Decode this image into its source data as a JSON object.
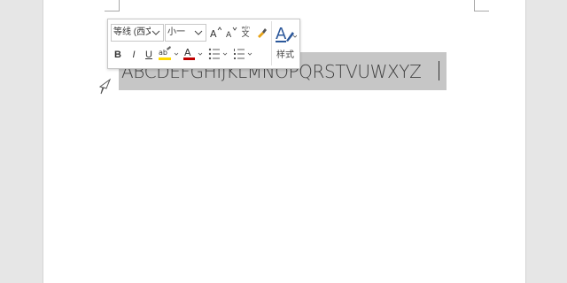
{
  "document": {
    "selected_text": "ABCDEFGHIJKLMNOPQRSTVUWXYZ"
  },
  "mini_toolbar": {
    "font_name": "等线 (西文",
    "font_size": "小一",
    "styles_label": "样式",
    "bold_label": "B",
    "italic_label": "I",
    "underline_label": "U",
    "colors": {
      "highlight": "#ffd800",
      "font_color": "#c00000",
      "styles_blue": "#2b579a"
    }
  },
  "icons": [
    "grow-font-icon",
    "shrink-font-icon",
    "phonetic-guide-icon",
    "format-painter-icon",
    "bold-icon",
    "italic-icon",
    "underline-icon",
    "highlight-icon",
    "font-color-icon",
    "bullets-icon",
    "numbering-icon",
    "styles-icon",
    "mouse-cursor-icon"
  ]
}
